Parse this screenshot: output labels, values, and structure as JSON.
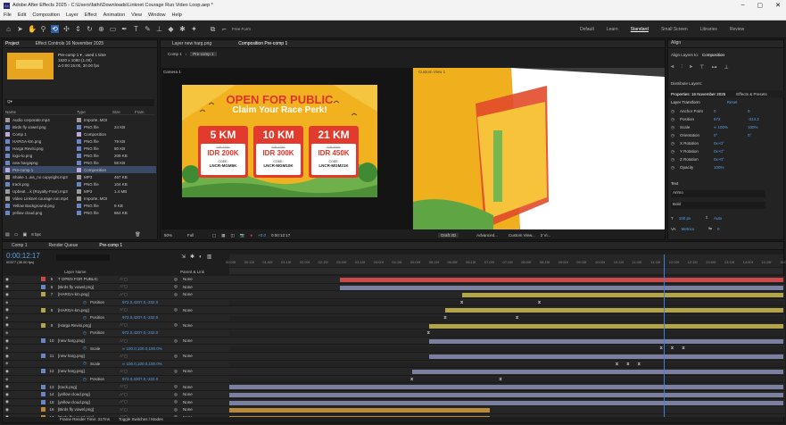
{
  "app": {
    "title": "Adobe After Effects 2025 - C:\\Users\\fathi\\Downloads\\Linknet Courage Run Video Loop.aep *",
    "menu": [
      "File",
      "Edit",
      "Composition",
      "Layer",
      "Effect",
      "Animation",
      "View",
      "Window",
      "Help"
    ],
    "workspaces": [
      "Default",
      "Learn",
      "Standard",
      "Small Screen",
      "Libraries",
      "Review"
    ],
    "freeform": "Free Form"
  },
  "project": {
    "tab": "Project",
    "effect_tab": "Effect Controls 16 November 2025",
    "thumb_name": "Pre-comp 1 ▾ , used 1 time",
    "thumb_info1": "1920 x 1080 (1.00)",
    "thumb_info2": "Δ 0:00:15:00, 30.00 fps",
    "search_placeholder": "Q▾",
    "headers": [
      "Name",
      "Type",
      "Size",
      "Fram"
    ],
    "files": [
      {
        "name": "Audio corporate.mp4",
        "type": "Importe..MOI",
        "size": "",
        "color": "#9a9a9a"
      },
      {
        "name": "Birds fly vowel.png",
        "type": "PNG file",
        "size": "24 KB",
        "color": "#6a86c2"
      },
      {
        "name": "Comp 1",
        "type": "Composition",
        "size": "",
        "color": "#bfa9d8"
      },
      {
        "name": "HARGA-km.png",
        "type": "PNG file",
        "size": "79 KB",
        "color": "#6a86c2"
      },
      {
        "name": "Harga Revisi.png",
        "type": "PNG file",
        "size": "80 KB",
        "color": "#6a86c2"
      },
      {
        "name": "logo-lo.png",
        "type": "PNG file",
        "size": "209 KB",
        "color": "#6a86c2"
      },
      {
        "name": "new hargapng",
        "type": "PNG file",
        "size": "58 KB",
        "color": "#6a86c2"
      },
      {
        "name": "Pre-comp 1",
        "type": "Composition",
        "size": "",
        "color": "#bfa9d8"
      },
      {
        "name": "Shake 1..ais_no copyright.mp3",
        "type": "MP3",
        "size": "467 KB",
        "color": "#9a9a9a"
      },
      {
        "name": "track.png",
        "type": "PNG file",
        "size": "104 KB",
        "color": "#6a86c2"
      },
      {
        "name": "Upbeat ...k (Royalty-Free).mp3",
        "type": "MP3",
        "size": "1.4 MB",
        "color": "#9a9a9a"
      },
      {
        "name": "Video Linknet courage run.mp4",
        "type": "Importe..MOI",
        "size": "",
        "color": "#9a9a9a"
      },
      {
        "name": "Yellow Background.png",
        "type": "PNG file",
        "size": "9 KB",
        "color": "#6a86c2"
      },
      {
        "name": "yellow cloud.png",
        "type": "PNG file",
        "size": "864 KB",
        "color": "#6a86c2"
      }
    ],
    "bpc": "8 bpc"
  },
  "composition": {
    "tab_layer": "Layer new harg.png",
    "tab_comp": "Composition Pre-comp 1",
    "crumb1": "Comp 1",
    "crumb2": "Pre-comp 1",
    "cam_left": "Camera 1",
    "cam_right": "Custom View 1",
    "zoom": "50%",
    "quality": "Full",
    "timecode": "0:00:12:17",
    "draft": "Draft 3D",
    "renderer": "Advanced...",
    "view": "Custom View...",
    "views": "2 Vi..."
  },
  "poster": {
    "title": "OPEN FOR PUBLIC",
    "subtitle": "Claim Your Race Perk!",
    "cards": [
      {
        "km": "5 KM",
        "old": "IDR 375K",
        "price": "IDR 200K",
        "code_lbl": "CODE:",
        "code": "LNCR-MGM5K"
      },
      {
        "km": "10 KM",
        "old": "IDR 425K",
        "price": "IDR 300K",
        "code_lbl": "CODE:",
        "code": "LNCR-MGM10K"
      },
      {
        "km": "21 KM",
        "old": "IDR 600K",
        "price": "IDR 450K",
        "code_lbl": "CODE:",
        "code": "LNCR-MGM21K"
      }
    ]
  },
  "right": {
    "align": "Align",
    "align_to_lbl": "Align Layers to:",
    "align_to": "Composition",
    "distribute": "Distribute Layers:",
    "props_title": "Properties: 16 November 2025",
    "effects": "Effects & Presets",
    "transform": "Layer Transform",
    "reset": "Reset",
    "props": [
      {
        "n": "Anchor Point",
        "v1": "0",
        "v2": "0"
      },
      {
        "n": "Position",
        "v1": "672",
        "v2": "-314.2"
      },
      {
        "n": "Scale",
        "v1": "∞ 100%",
        "v2": "100%"
      },
      {
        "n": "Orientation",
        "v1": "0°",
        "v2": "0°"
      },
      {
        "n": "X Rotation",
        "v1": "0x+0°",
        "v2": ""
      },
      {
        "n": "Y Rotation",
        "v1": "0x+0°",
        "v2": ""
      },
      {
        "n": "Z Rotation",
        "v1": "0x+0°",
        "v2": ""
      },
      {
        "n": "Opacity",
        "v1": "100%",
        "v2": ""
      }
    ],
    "text": "Text",
    "font": "Arimo",
    "style": "Bold",
    "size": "100 px",
    "auto": "Auto",
    "metrics": "Metrics",
    "leading": "0"
  },
  "timeline": {
    "tabs": [
      "Comp 1",
      "Render Queue",
      "Pre-comp 1"
    ],
    "time": "0:00:12:17",
    "frames": "00377 (30.00 fps)",
    "headers": [
      "Layer Name",
      "Parent & Link"
    ],
    "ruler": [
      "00:00f",
      "00:15f",
      "01:00f",
      "01:15f",
      "02:00f",
      "02:15f",
      "03:00f",
      "03:15f",
      "04:00f",
      "04:15f",
      "05:00f",
      "05:15f",
      "06:00f",
      "06:15f",
      "07:00f",
      "07:15f",
      "08:00f",
      "08:15f",
      "09:00f",
      "09:15f",
      "10:00f",
      "10:15f",
      "11:00f",
      "11:15f",
      "12:00f",
      "12:15f",
      "13:00f",
      "13:15f",
      "14:00f",
      "14:15f",
      "15:0"
    ],
    "layers": [
      {
        "num": "5",
        "name": "T OPEN FOR PUBLIC",
        "parent": "None",
        "color": "#c94a4a",
        "s": 0.2,
        "e": 1.0,
        "kind": "layer"
      },
      {
        "num": "6",
        "name": "[Birds fly vowel.png]",
        "parent": "None",
        "color": "#6a86c2",
        "s": 0.2,
        "e": 1.0,
        "kind": "layer"
      },
      {
        "num": "7",
        "name": "[HARGA-km.png]",
        "parent": "None",
        "color": "#b4a54a",
        "s": 0.42,
        "e": 1.0,
        "kind": "layer"
      },
      {
        "num": "",
        "name": "Position",
        "parent": "972.0,420?.0,-232.0",
        "color": "",
        "s": 0,
        "e": 0,
        "kind": "prop",
        "keys": [
          0.42,
          0.56
        ]
      },
      {
        "num": "8",
        "name": "[HARGA-km.png]",
        "parent": "None",
        "color": "#b4a54a",
        "s": 0.39,
        "e": 1.0,
        "kind": "layer"
      },
      {
        "num": "",
        "name": "Position",
        "parent": "972.0,420?.0,-232.0",
        "color": "",
        "s": 0,
        "e": 0,
        "kind": "prop",
        "keys": [
          0.39,
          0.52
        ]
      },
      {
        "num": "9",
        "name": "[Harga Revisi.png]",
        "parent": "None",
        "color": "#b4a54a",
        "s": 0.36,
        "e": 1.0,
        "kind": "layer"
      },
      {
        "num": "",
        "name": "Position",
        "parent": "972.0,420?.0,-232.0",
        "color": "",
        "s": 0,
        "e": 0,
        "kind": "prop",
        "keys": [
          0.36
        ]
      },
      {
        "num": "10",
        "name": "[new harg.png]",
        "parent": "None",
        "color": "#6a86c2",
        "s": 0.36,
        "e": 1.0,
        "kind": "layer"
      },
      {
        "num": "",
        "name": "Scale",
        "parent": "∞ 100.0,100.0,100.0%",
        "color": "",
        "s": 0,
        "e": 0,
        "kind": "prop",
        "keys": [
          0.78,
          0.8,
          0.82
        ]
      },
      {
        "num": "11",
        "name": "[new harg.png]",
        "parent": "None",
        "color": "#6a86c2",
        "s": 0.36,
        "e": 1.0,
        "kind": "layer"
      },
      {
        "num": "",
        "name": "Scale",
        "parent": "∞ 100.0,100.0,100.0%",
        "color": "",
        "s": 0,
        "e": 0,
        "kind": "prop",
        "keys": [
          0.7,
          0.72,
          0.74
        ]
      },
      {
        "num": "12",
        "name": "[new harg.png]",
        "parent": "None",
        "color": "#6a86c2",
        "s": 0.33,
        "e": 1.0,
        "kind": "layer"
      },
      {
        "num": "",
        "name": "Position",
        "parent": "972.0,420?.0,-232.0",
        "color": "",
        "s": 0,
        "e": 0,
        "kind": "prop",
        "keys": [
          0.33,
          0.49
        ]
      },
      {
        "num": "13",
        "name": "[track.png]",
        "parent": "None",
        "color": "#6a86c2",
        "s": 0.0,
        "e": 1.0,
        "kind": "layer"
      },
      {
        "num": "14",
        "name": "[yellow cloud.png]",
        "parent": "None",
        "color": "#6a86c2",
        "s": 0.0,
        "e": 1.0,
        "kind": "layer"
      },
      {
        "num": "15",
        "name": "[yellow cloud.png]",
        "parent": "None",
        "color": "#6a86c2",
        "s": 0.0,
        "e": 1.0,
        "kind": "layer"
      },
      {
        "num": "16",
        "name": "[Birds fly vowel.png]",
        "parent": "None",
        "color": "#b98a3a",
        "s": 0.0,
        "e": 0.47,
        "kind": "layer"
      },
      {
        "num": "17",
        "name": "[Birds fly vowel.png]",
        "parent": "None",
        "color": "#b98a3a",
        "s": 0.0,
        "e": 0.47,
        "kind": "layer"
      },
      {
        "num": "18",
        "name": "[yellow cloud.png]",
        "parent": "None",
        "color": "#b98a3a",
        "s": 0.0,
        "e": 0.47,
        "kind": "layer"
      },
      {
        "num": "19",
        "name": "[yellow cloud.png]",
        "parent": "None",
        "color": "#b98a3a",
        "s": 0.0,
        "e": 0.47,
        "kind": "layer"
      }
    ],
    "footer": "Frame Render Time: 317ms",
    "footer2": "Toggle Switches / Modes",
    "playhead": 0.785
  }
}
